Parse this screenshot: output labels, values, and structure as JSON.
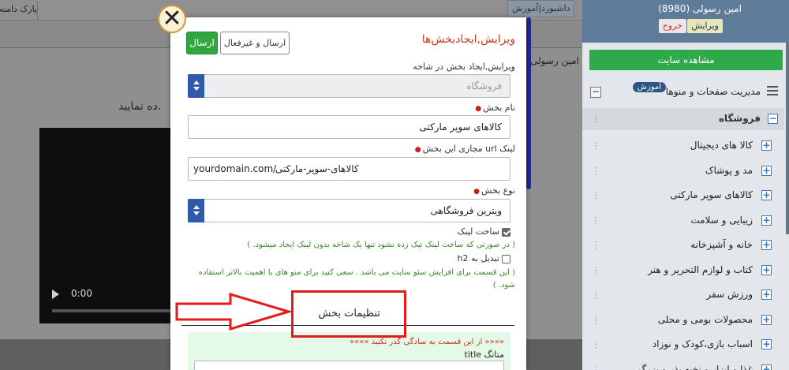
{
  "background": {
    "tabs": {
      "dashboard": "داشبورد",
      "training": "آموزش"
    },
    "parking_label": "پارک دامنه",
    "sidebar_title": "امین رسولی",
    "body_text": "ده نمایید.",
    "video_time": "0:00"
  },
  "sidebar": {
    "user": "امین رسولی (8980)",
    "edit_label": "ویرایش",
    "exit_label": "خروج",
    "view_site_label": "مشاهده سایت",
    "menu_header": "مدیریت صفحات و منوها",
    "menu_badge": "آموزش",
    "shop_label": "فروشگاه",
    "categories": [
      "کالا های دیجیتال",
      "مد و پوشاک",
      "کالاهای سوپر مارکتی",
      "زیبایی و سلامت",
      "خانه و آشپزخانه",
      "کتاب و لوازم التحریر و هنر",
      "ورزش سفر",
      "محصولات بومی و محلی",
      "اسباب بازی،کودک و نوزاد",
      "غذا و ابزار و نخبه بذر و بزرگ"
    ]
  },
  "modal": {
    "title": "ویرایش,ایجادبخش‌ها",
    "send_label": "ارسال",
    "send_inactive_label": "ارسال و غیرفعال",
    "parent_label": "ویرایش,ایجاد بخش در شاخه",
    "parent_placeholder": "فروشگاه",
    "name_label": "نام بخش",
    "name_value": "کالاهای سوپر مارکتی",
    "url_label": "لینک url مجازی این بخش",
    "url_domain": "yourdomain.com/",
    "url_slug": "کالاهای-سوپر-مارکتی",
    "type_label": "نوع بخش",
    "type_value": "ویترین فروشگاهی",
    "make_link_label": "ساخت لینک",
    "make_link_checked": true,
    "make_link_hint": "( در صورتی که ساخت لینک تیک زده نشود تنها یک شاخه بدون لینک ایجاد میشود. )",
    "h2_label": "تبدیل به h2",
    "h2_checked": false,
    "h2_hint": "( این قسمت برای افزایش سئو سایت می باشد . سعی کنید برای منو های با اهمیت بالاتر استفاده شود. )",
    "settings_title": "تنظیمات بخش",
    "settings_note": "«««« از این قسمت به سادگی گذر نکنید »»»»",
    "meta_title_label": "متاتگ title"
  },
  "colors": {
    "accent_green": "#2fa73f",
    "title_red": "#c5391f",
    "annotation_red": "#e31b1b",
    "select_blue": "#2e5aa8"
  }
}
